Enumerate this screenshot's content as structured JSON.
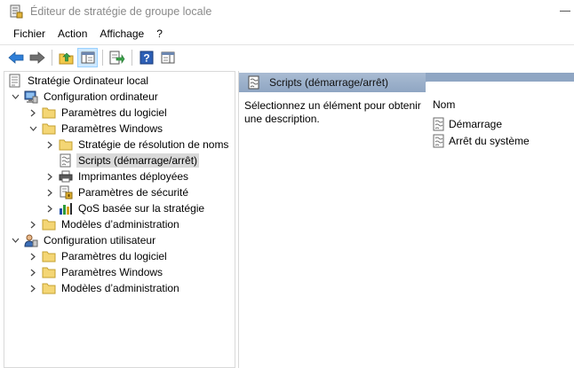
{
  "window": {
    "title": "Éditeur de stratégie de groupe locale"
  },
  "menu": [
    "Fichier",
    "Action",
    "Affichage",
    "?"
  ],
  "toolbar": {
    "buttons": [
      "back-icon",
      "forward-icon",
      "up-folder-icon",
      "show-hide-tree-icon",
      "export-list-icon",
      "help-icon",
      "properties-pane-icon"
    ]
  },
  "tree": {
    "root": "Stratégie Ordinateur local",
    "computer_config": "Configuration ordinateur",
    "cc_software": "Paramètres du logiciel",
    "cc_windows": "Paramètres Windows",
    "cc_name_resolution": "Stratégie de résolution de noms",
    "cc_scripts": "Scripts (démarrage/arrêt)",
    "cc_printers": "Imprimantes déployées",
    "cc_security": "Paramètres de sécurité",
    "cc_qos": "QoS basée sur la stratégie",
    "cc_admin_templates": "Modèles d’administration",
    "user_config": "Configuration utilisateur",
    "uc_software": "Paramètres du logiciel",
    "uc_windows": "Paramètres Windows",
    "uc_admin_templates": "Modèles d’administration"
  },
  "details": {
    "header": "Scripts (démarrage/arrêt)",
    "description": "Sélectionnez un élément pour obtenir une description.",
    "column_name": "Nom",
    "items": [
      "Démarrage",
      "Arrêt du système"
    ]
  }
}
